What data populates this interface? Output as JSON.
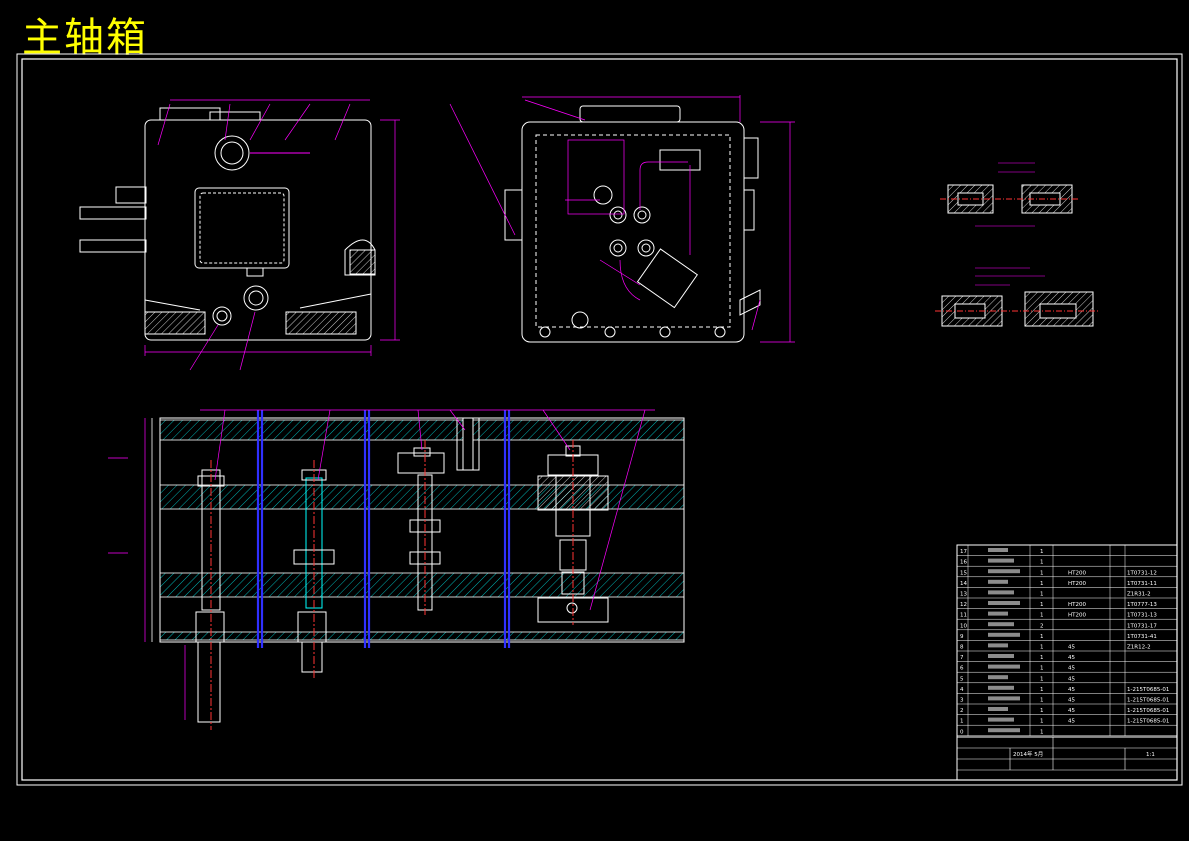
{
  "title": "主轴箱",
  "parts_list": {
    "rows": [
      {
        "no": "17",
        "name": "",
        "qty": "1",
        "material": "",
        "code": ""
      },
      {
        "no": "16",
        "name": "",
        "qty": "1",
        "material": "",
        "code": ""
      },
      {
        "no": "15",
        "name": "",
        "qty": "1",
        "material": "HT200",
        "code": "1T0731-12"
      },
      {
        "no": "14",
        "name": "",
        "qty": "1",
        "material": "HT200",
        "code": "1T0731-11"
      },
      {
        "no": "13",
        "name": "",
        "qty": "1",
        "material": "",
        "code": "Z1R31-2"
      },
      {
        "no": "12",
        "name": "",
        "qty": "1",
        "material": "HT200",
        "code": "1T0777-13"
      },
      {
        "no": "11",
        "name": "",
        "qty": "1",
        "material": "HT200",
        "code": "1T0731-13"
      },
      {
        "no": "10",
        "name": "",
        "qty": "2",
        "material": "",
        "code": "1T0731-17"
      },
      {
        "no": "9",
        "name": "",
        "qty": "1",
        "material": "",
        "code": "1T0731-41"
      },
      {
        "no": "8",
        "name": "",
        "qty": "1",
        "material": "45",
        "code": "Z1R12-2"
      },
      {
        "no": "7",
        "name": "",
        "qty": "1",
        "material": "45",
        "code": ""
      },
      {
        "no": "6",
        "name": "",
        "qty": "1",
        "material": "45",
        "code": ""
      },
      {
        "no": "5",
        "name": "",
        "qty": "1",
        "material": "45",
        "code": ""
      },
      {
        "no": "4",
        "name": "",
        "qty": "1",
        "material": "45",
        "code": "1-215T0685-01"
      },
      {
        "no": "3",
        "name": "",
        "qty": "1",
        "material": "45",
        "code": "1-215T0685-01"
      },
      {
        "no": "2",
        "name": "",
        "qty": "1",
        "material": "45",
        "code": "1-215T0685-01"
      },
      {
        "no": "1",
        "name": "",
        "qty": "1",
        "material": "45",
        "code": "1-215T0685-01"
      },
      {
        "no": "0",
        "name": "",
        "qty": "1",
        "material": "",
        "code": ""
      }
    ],
    "date": "2014年 5月",
    "scale": "1:1"
  },
  "colors": {
    "background": "#000000",
    "outline": "#ffffff",
    "title": "#ffff00",
    "dimension": "#ff00ff",
    "hatch": "#00ffff",
    "centerline": "#ff3333",
    "hidden": "#0000ff"
  }
}
